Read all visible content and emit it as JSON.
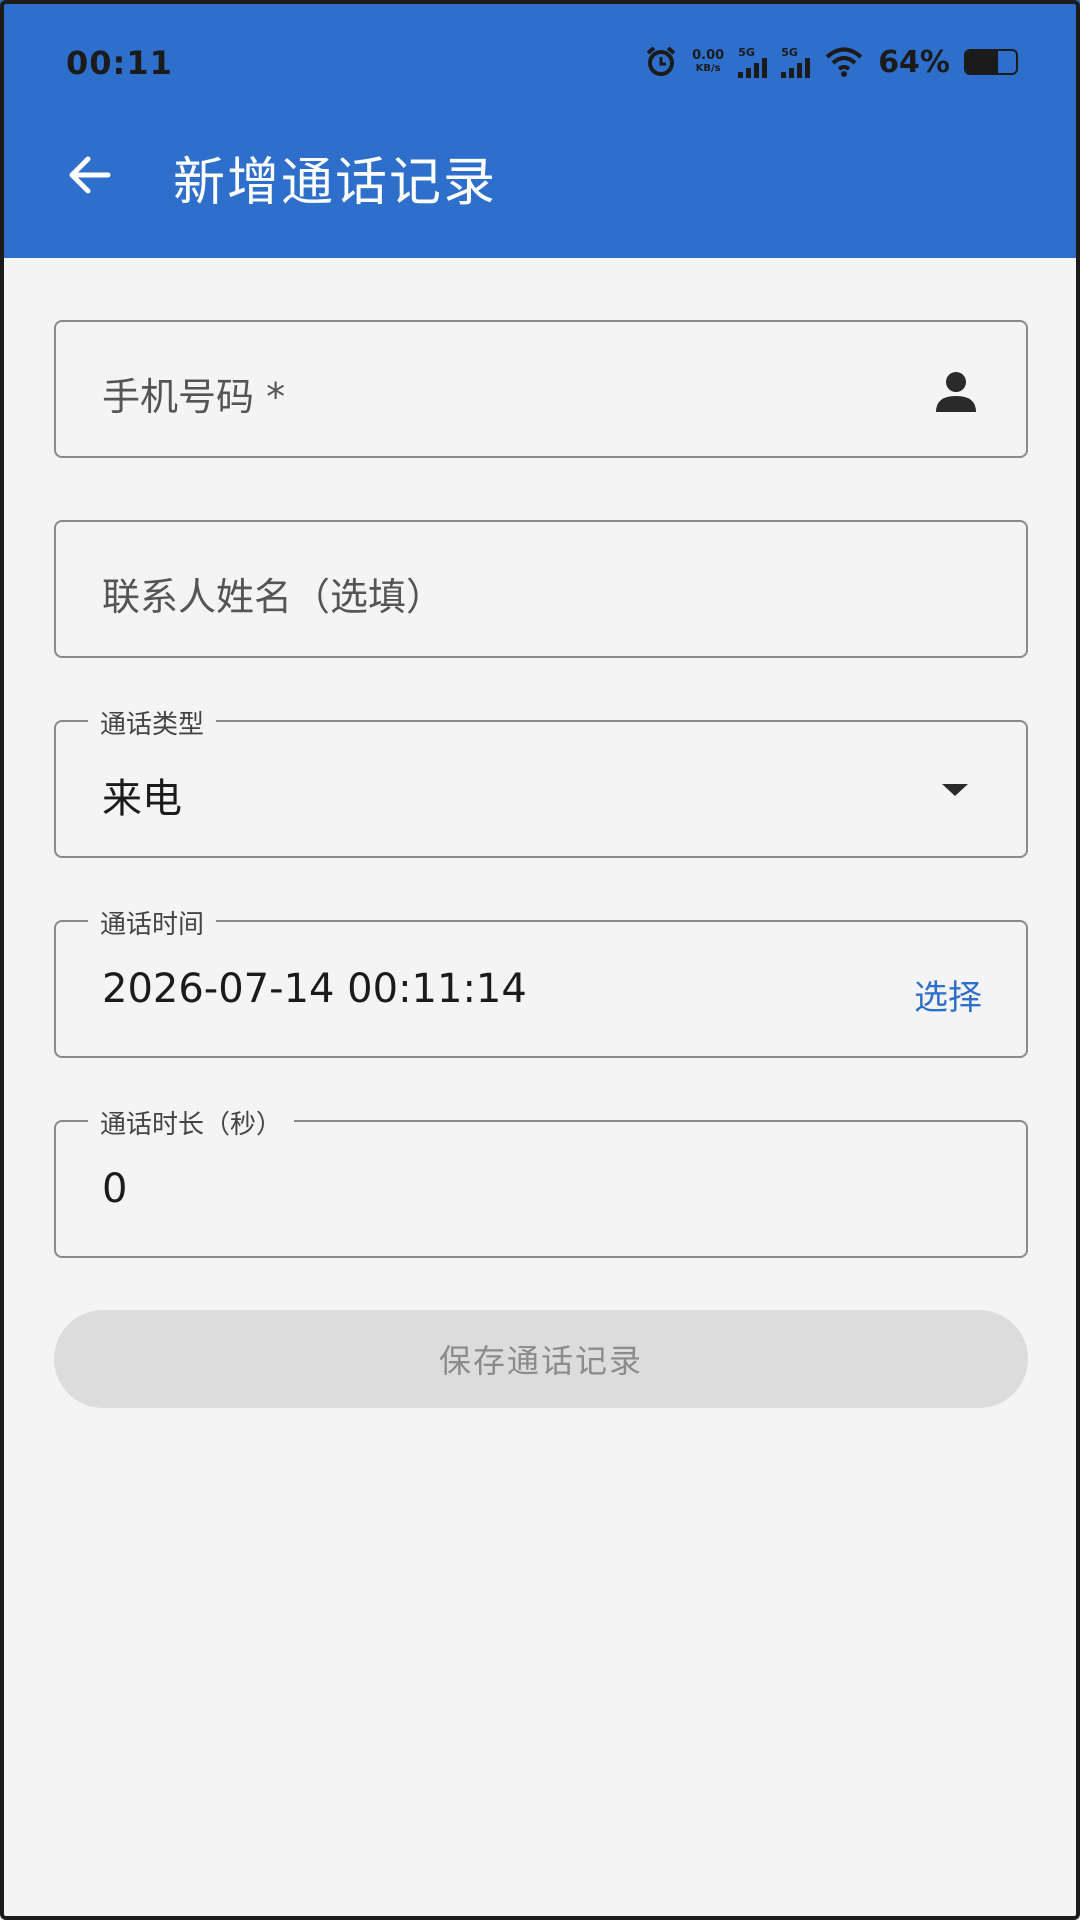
{
  "status_bar": {
    "time": "00:11",
    "net_speed_value": "0.00",
    "net_speed_unit": "KB/s",
    "sim1_label": "5G",
    "sim2_label": "5G",
    "battery": "64%",
    "battery_level": 0.64,
    "icons": [
      "alarm-icon",
      "signal-icon",
      "wifi-icon",
      "battery-icon"
    ]
  },
  "app_bar": {
    "title": "新增通话记录",
    "back_icon": "arrow-left-icon",
    "color": "#2e6fcc"
  },
  "form": {
    "phone": {
      "placeholder": "手机号码 *",
      "icon": "person-icon"
    },
    "contact_name": {
      "placeholder": "联系人姓名（选填）"
    },
    "call_type": {
      "label": "通话类型",
      "value": "来电",
      "icon": "dropdown-arrow-icon"
    },
    "call_time": {
      "label": "通话时间",
      "value": "2026-07-14 00:11:14",
      "action": "选择"
    },
    "duration": {
      "label": "通话时长（秒）",
      "value": "0"
    },
    "save_label": "保存通话记录"
  }
}
